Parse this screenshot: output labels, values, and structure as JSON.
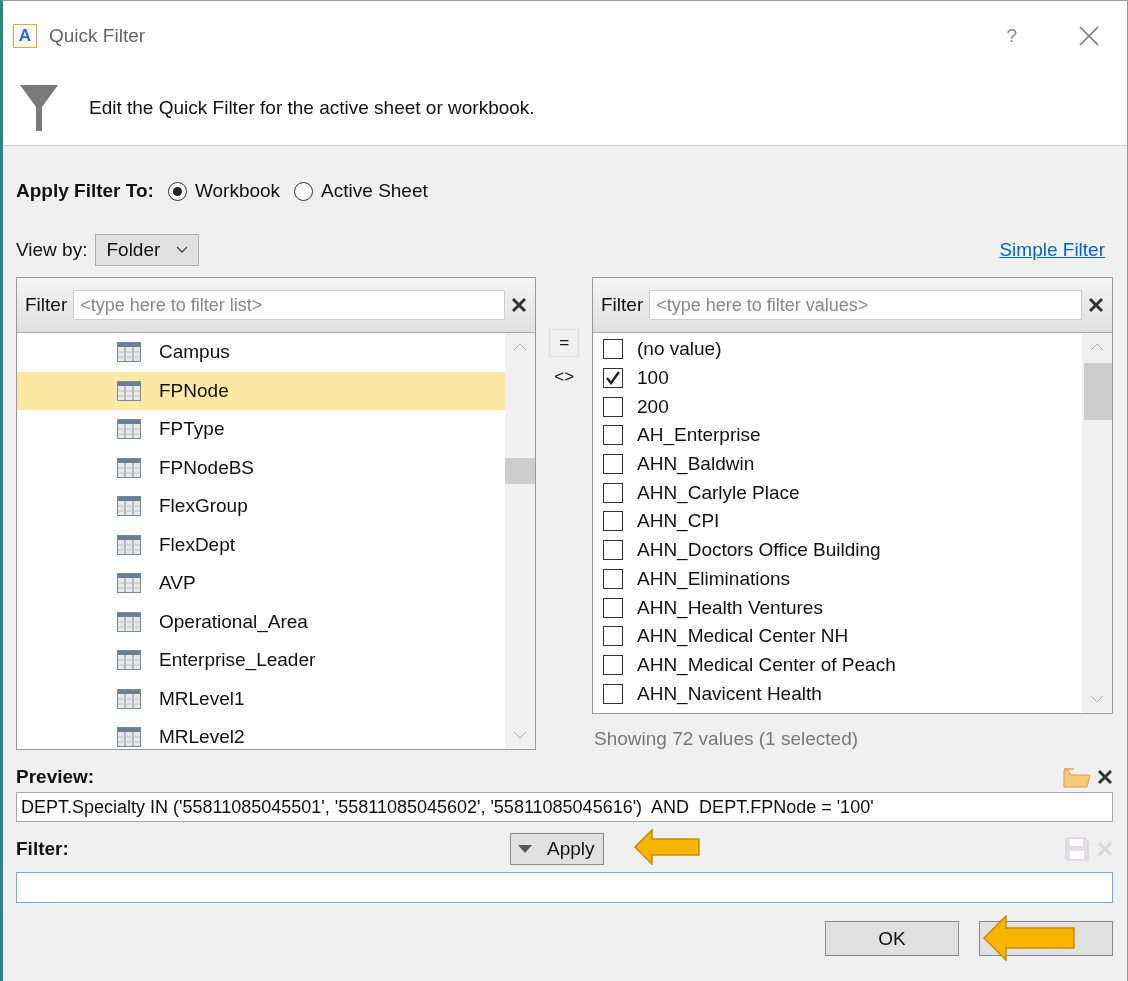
{
  "window": {
    "icon_letter": "A",
    "title": "Quick Filter",
    "help": "?"
  },
  "header": {
    "description": "Edit the Quick Filter for the active sheet or workbook."
  },
  "apply_filter_to": {
    "label": "Apply Filter To:",
    "options": [
      {
        "label": "Workbook",
        "selected": true
      },
      {
        "label": "Active Sheet",
        "selected": false
      }
    ]
  },
  "view_by": {
    "label": "View by:",
    "value": "Folder"
  },
  "simple_filter_link": "Simple Filter",
  "fields_list": {
    "filter_label": "Filter",
    "placeholder": "<type here to filter list>",
    "items": [
      {
        "label": "Campus",
        "selected": false
      },
      {
        "label": "FPNode",
        "selected": true
      },
      {
        "label": "FPType",
        "selected": false
      },
      {
        "label": "FPNodeBS",
        "selected": false
      },
      {
        "label": "FlexGroup",
        "selected": false
      },
      {
        "label": "FlexDept",
        "selected": false
      },
      {
        "label": "AVP",
        "selected": false
      },
      {
        "label": "Operational_Area",
        "selected": false
      },
      {
        "label": "Enterprise_Leader",
        "selected": false
      },
      {
        "label": "MRLevel1",
        "selected": false
      },
      {
        "label": "MRLevel2",
        "selected": false
      }
    ]
  },
  "operators": [
    "=",
    "<>"
  ],
  "values_list": {
    "filter_label": "Filter",
    "placeholder": "<type here to filter values>",
    "items": [
      {
        "label": "(no value)",
        "checked": false
      },
      {
        "label": "100",
        "checked": true
      },
      {
        "label": "200",
        "checked": false
      },
      {
        "label": "AH_Enterprise",
        "checked": false
      },
      {
        "label": "AHN_Baldwin",
        "checked": false
      },
      {
        "label": "AHN_Carlyle Place",
        "checked": false
      },
      {
        "label": "AHN_CPI",
        "checked": false
      },
      {
        "label": "AHN_Doctors Office Building",
        "checked": false
      },
      {
        "label": "AHN_Eliminations",
        "checked": false
      },
      {
        "label": "AHN_Health Ventures",
        "checked": false
      },
      {
        "label": "AHN_Medical Center NH",
        "checked": false
      },
      {
        "label": "AHN_Medical Center of Peach",
        "checked": false
      },
      {
        "label": "AHN_Navicent Health",
        "checked": false
      }
    ],
    "status": "Showing 72 values (1 selected)"
  },
  "preview": {
    "label": "Preview:",
    "value": "DEPT.Specialty IN ('55811085045501', '55811085045602', '55811085045616')  AND  DEPT.FPNode = '100'"
  },
  "filter": {
    "label": "Filter:",
    "apply_button": "Apply"
  },
  "buttons": [
    {
      "label": "OK"
    }
  ]
}
